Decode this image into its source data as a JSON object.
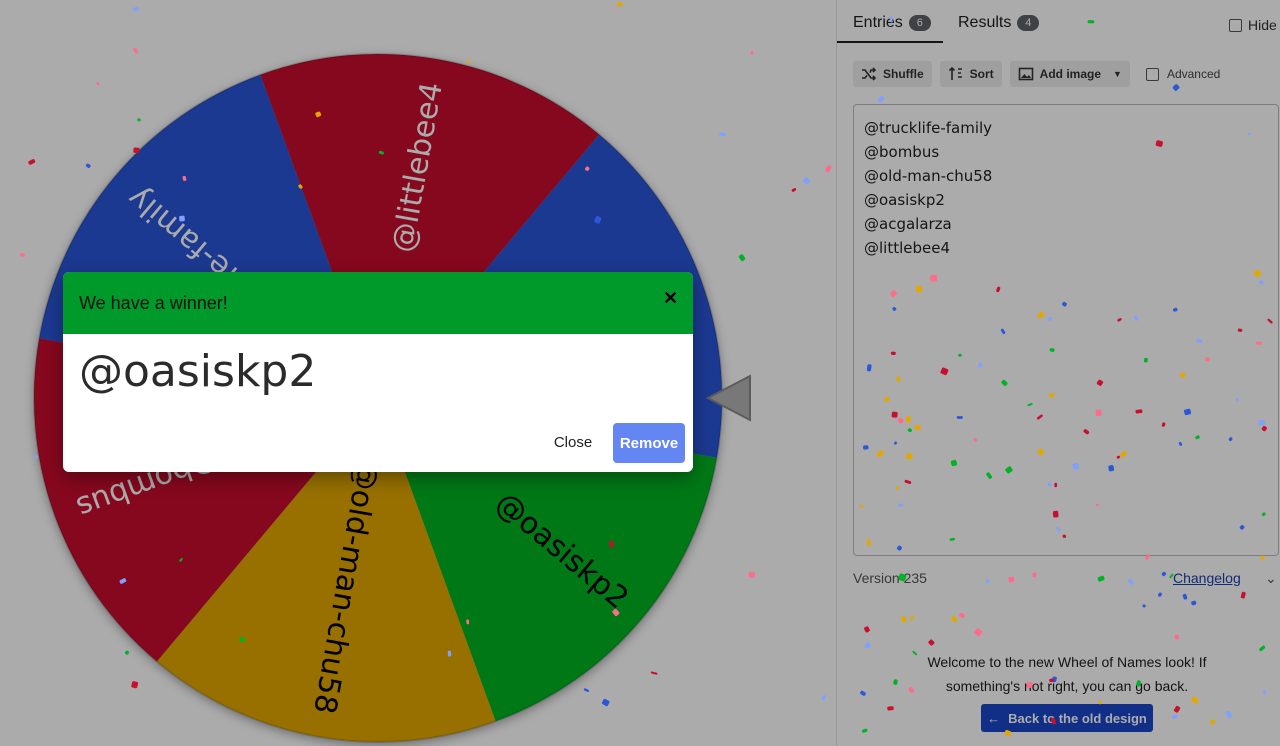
{
  "wheel": {
    "segments": [
      {
        "label": "@littlebee4",
        "color": "#c8102e"
      },
      {
        "label": "@acgalarza",
        "color": "#2b57d9"
      },
      {
        "label": "@oasiskp2",
        "color": "#00b324"
      },
      {
        "label": "@old-man-chu58",
        "color": "#e2a800"
      },
      {
        "label": "@bombus",
        "color": "#c8102e"
      },
      {
        "label": "@trucklife-family",
        "color": "#2b57d9"
      }
    ]
  },
  "tabs": {
    "entries_label": "Entries",
    "entries_count": "6",
    "results_label": "Results",
    "results_count": "4",
    "hide_label": "Hide"
  },
  "toolbar": {
    "shuffle": "Shuffle",
    "sort": "Sort",
    "add_image": "Add image",
    "advanced": "Advanced"
  },
  "entries": [
    "@trucklife-family",
    "@bombus",
    "@old-man-chu58",
    "@oasiskp2",
    "@acgalarza",
    "@littlebee4"
  ],
  "footer": {
    "version": "Version 235",
    "changelog": "Changelog",
    "welcome": "Welcome to the new Wheel of Names look! If something's not right, you can go back.",
    "back_button": "Back to the old design"
  },
  "dialog": {
    "title": "We have a winner!",
    "winner": "@oasiskp2",
    "close": "Close",
    "remove": "Remove"
  }
}
